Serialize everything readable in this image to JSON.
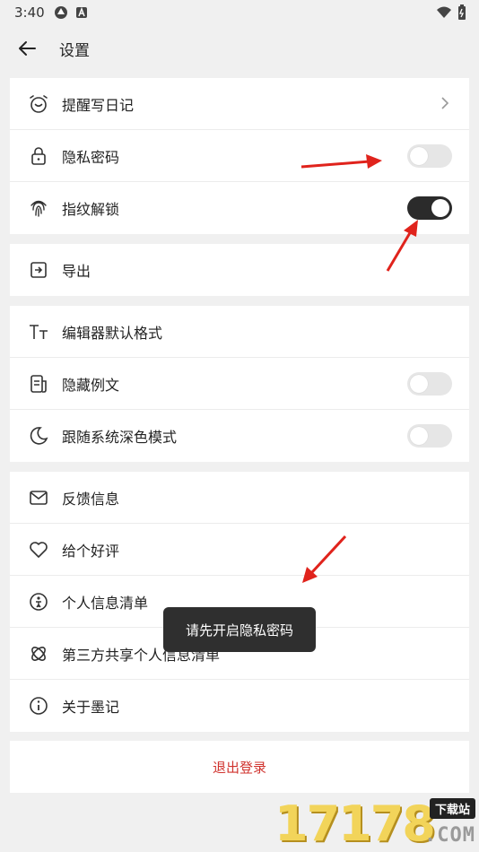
{
  "status_bar": {
    "time": "3:40",
    "battery": "+"
  },
  "header": {
    "title": "设置"
  },
  "group1": {
    "remind": "提醒写日记",
    "privacy_password": "隐私密码",
    "privacy_password_on": false,
    "fingerprint": "指纹解锁",
    "fingerprint_on": true
  },
  "group2": {
    "export": "导出"
  },
  "group3": {
    "editor_format": "编辑器默认格式",
    "hide_examples": "隐藏例文",
    "hide_examples_on": false,
    "dark_mode": "跟随系统深色模式",
    "dark_mode_on": false
  },
  "group4": {
    "feedback": "反馈信息",
    "rate": "给个好评",
    "personal_info": "个人信息清单",
    "third_party": "第三方共享个人信息清单",
    "about": "关于墨记"
  },
  "logout": "退出登录",
  "toast": "请先开启隐私密码",
  "watermark": {
    "digits": "17178",
    "badge": "下载站",
    "com": ".COM"
  },
  "colors": {
    "danger": "#d0332e",
    "toggle_on": "#2b2b2b",
    "annotation_arrow": "#e0231c"
  }
}
